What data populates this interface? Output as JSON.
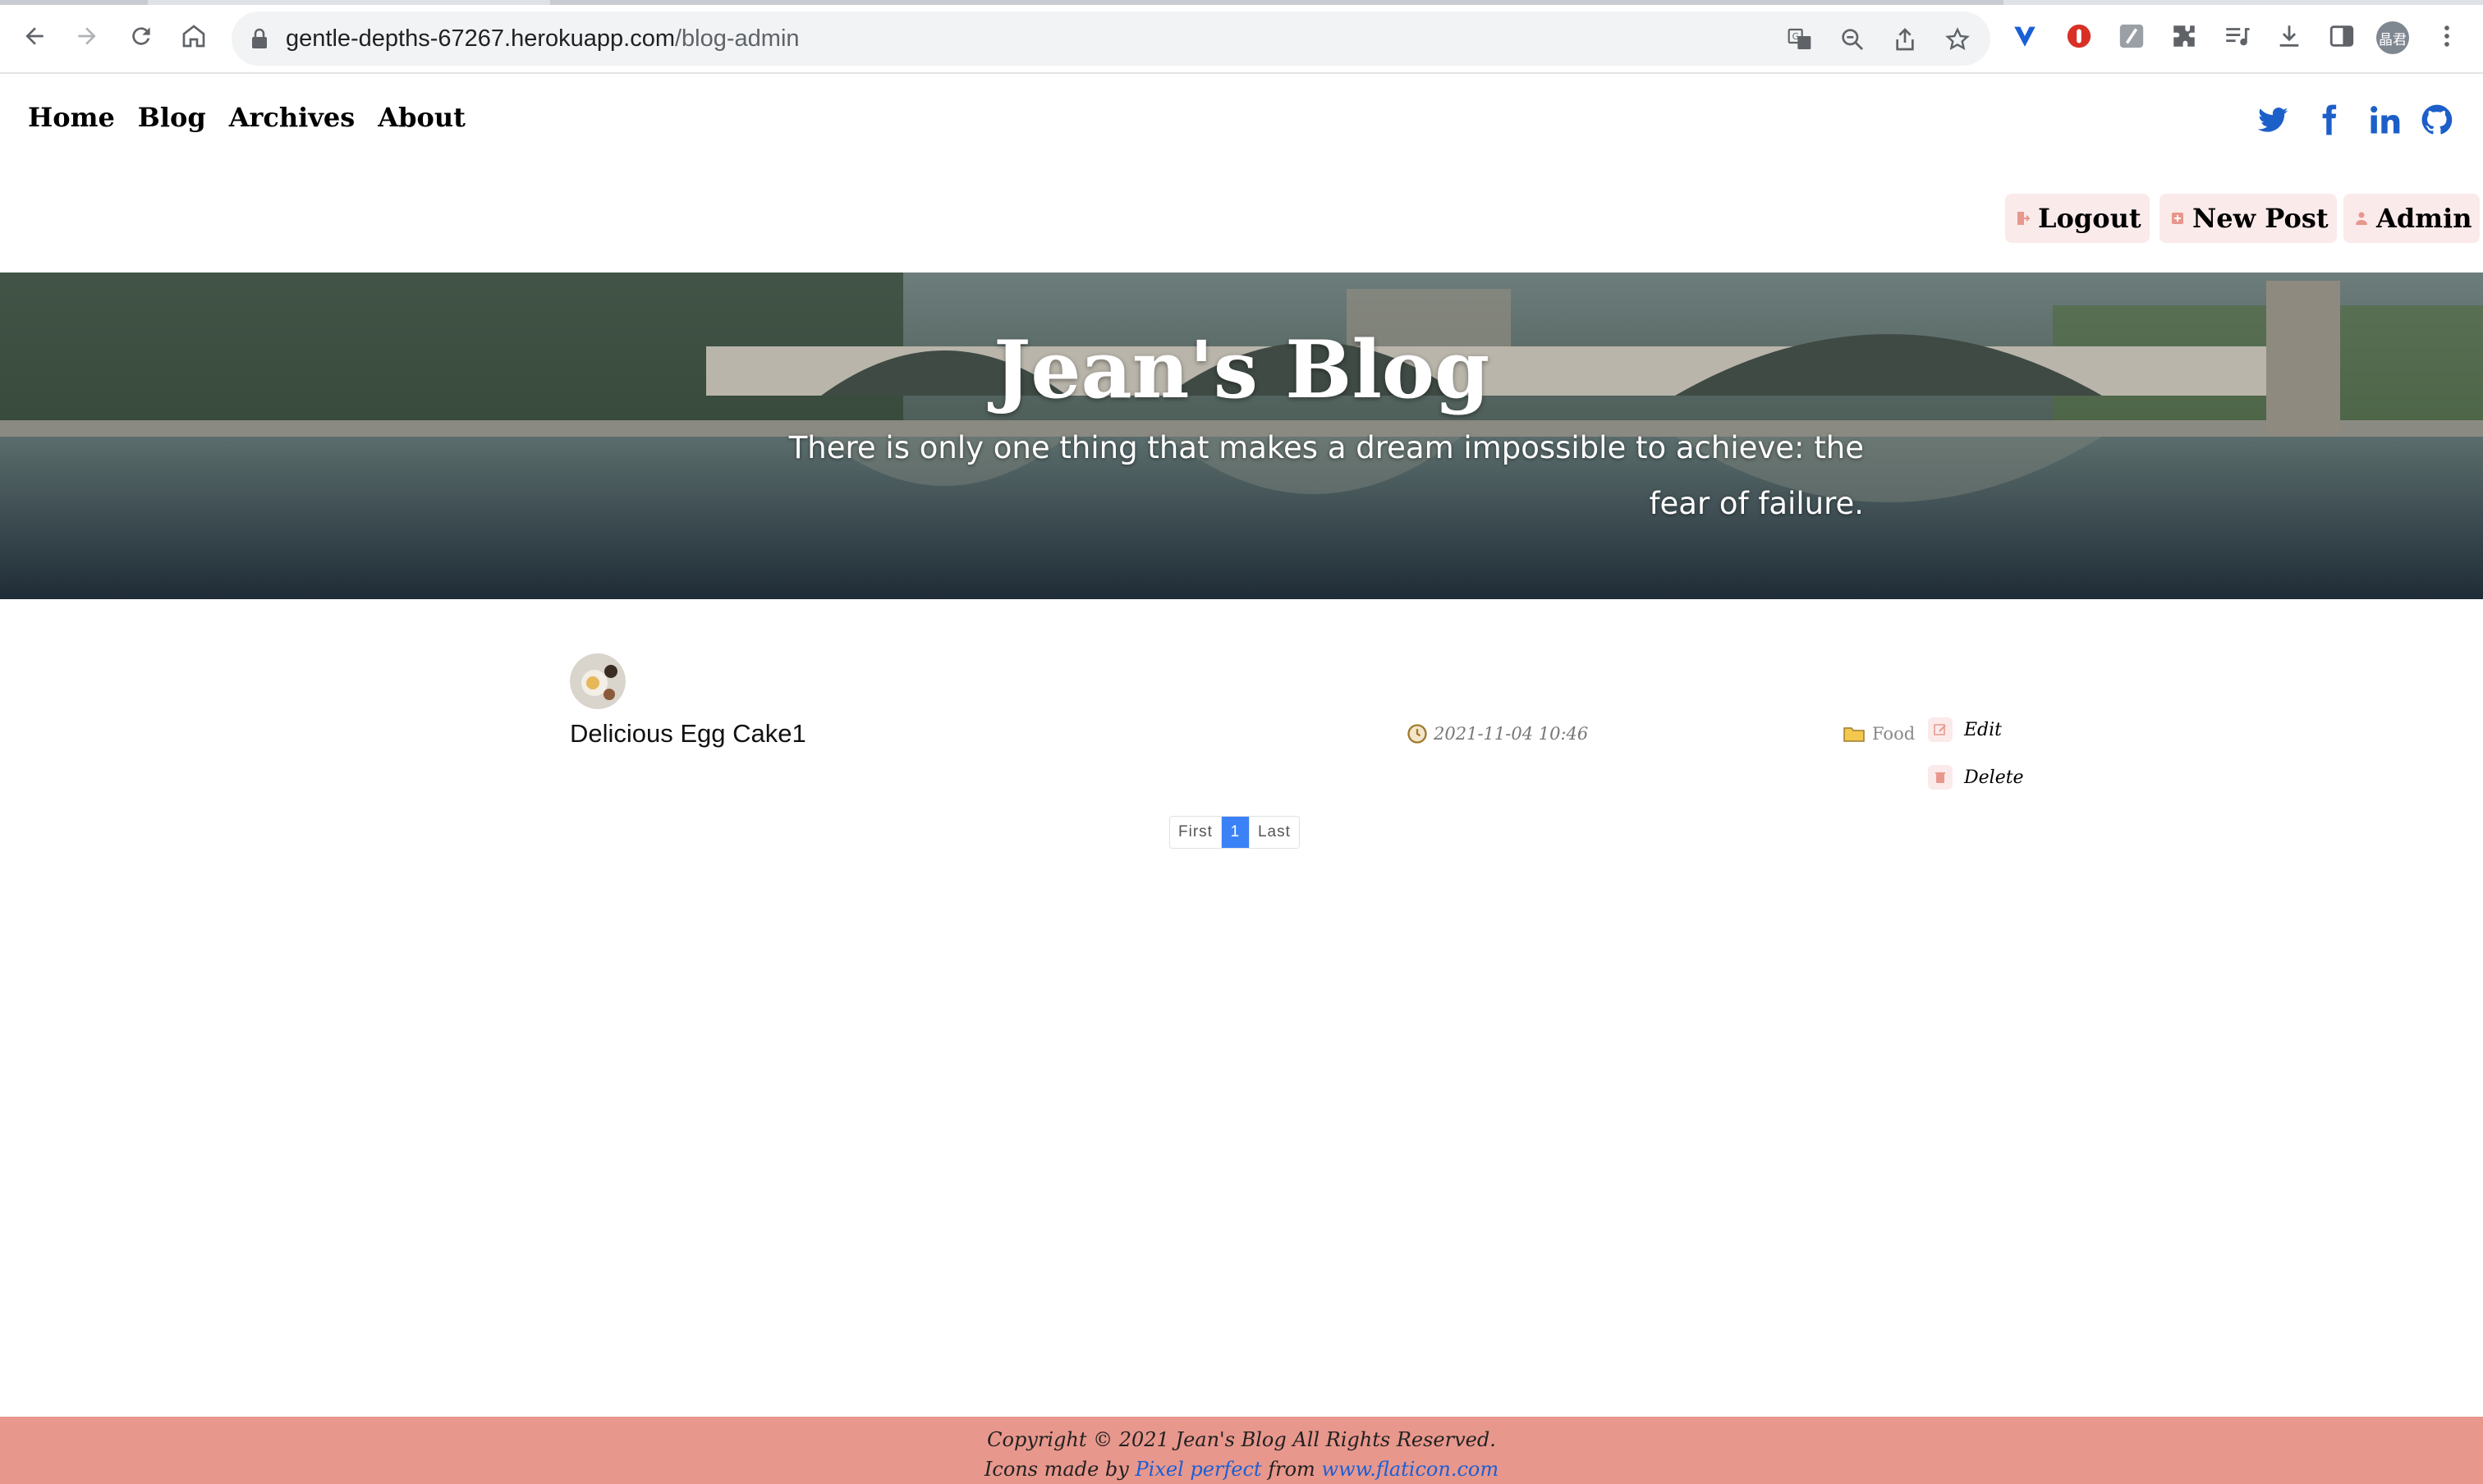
{
  "browser": {
    "url_host": "gentle-depths-67267.herokuapp.com",
    "url_path": "/blog-admin",
    "profile_initials": "晶君"
  },
  "site_nav": {
    "items": [
      {
        "label": "Home"
      },
      {
        "label": "Blog"
      },
      {
        "label": "Archives"
      },
      {
        "label": "About"
      }
    ],
    "social_icons": [
      "twitter-icon",
      "facebook-icon",
      "linkedin-icon",
      "github-icon"
    ],
    "social_color": "#1d5fc9"
  },
  "admin_actions": {
    "logout": "Logout",
    "new_post": "New Post",
    "admin": "Admin"
  },
  "hero": {
    "title": "Jean's Blog",
    "subtitle_line1": "There is only one thing that makes a dream impossible to achieve: the",
    "subtitle_line2": "fear of failure."
  },
  "posts": [
    {
      "title": "Delicious Egg Cake1",
      "datetime": "2021-11-04 10:46",
      "category": "Food",
      "edit_label": "Edit",
      "delete_label": "Delete"
    }
  ],
  "pagination": {
    "first": "First",
    "current": "1",
    "last": "Last"
  },
  "footer": {
    "copyright": "Copyright © 2021 Jean's Blog All Rights Reserved.",
    "icons_prefix": "Icons made by",
    "icons_author": "Pixel perfect",
    "icons_from": "from",
    "icons_site": "www.flaticon.com"
  },
  "colors": {
    "footer_bg": "#e8978c",
    "pagination_active": "#3b82f6",
    "action_bg": "#fbeaea"
  }
}
